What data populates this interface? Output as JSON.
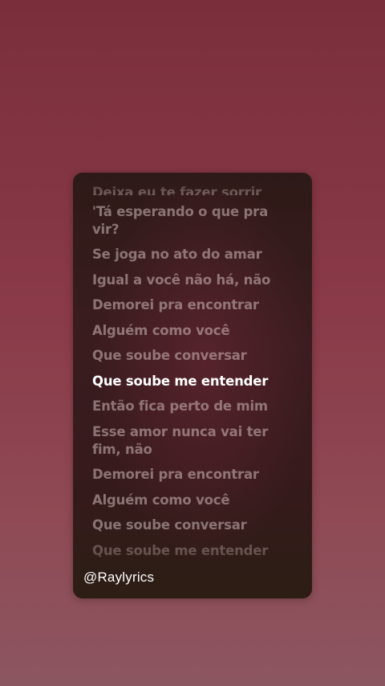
{
  "lyrics": {
    "lines": [
      "Deixa eu te fazer sorrir",
      "'Tá esperando o que pra vir?",
      "Se joga no ato do amar",
      "Igual a você não há, não",
      "Demorei pra encontrar",
      "Alguém como você",
      "Que soube conversar",
      "Que soube me entender",
      "Então fica perto de mim",
      "Esse amor nunca vai ter fim, não",
      "Demorei pra encontrar",
      "Alguém como você",
      "Que soube conversar",
      "Que soube me entender"
    ],
    "active_index": 7
  },
  "watermark": "@Raylyrics"
}
